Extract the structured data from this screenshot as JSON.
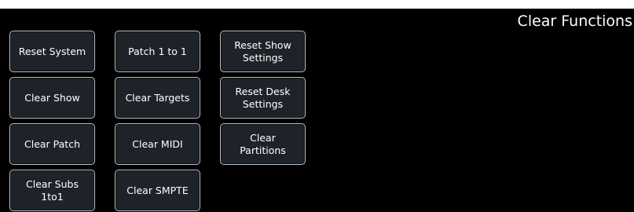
{
  "panel": {
    "title": "Clear Functions"
  },
  "buttons": {
    "col1": [
      "Reset System",
      "Clear Show",
      "Clear Patch",
      "Clear Subs\n1to1"
    ],
    "col2": [
      "Patch 1 to 1",
      "Clear Targets",
      "Clear MIDI",
      "Clear SMPTE"
    ],
    "col3": [
      "Reset Show\nSettings",
      "Reset Desk\nSettings",
      "Clear\nPartitions"
    ]
  },
  "colors": {
    "background": "#000000",
    "button_fill": "#1e2329",
    "button_border": "#b9bec4",
    "text": "#ffffff"
  }
}
